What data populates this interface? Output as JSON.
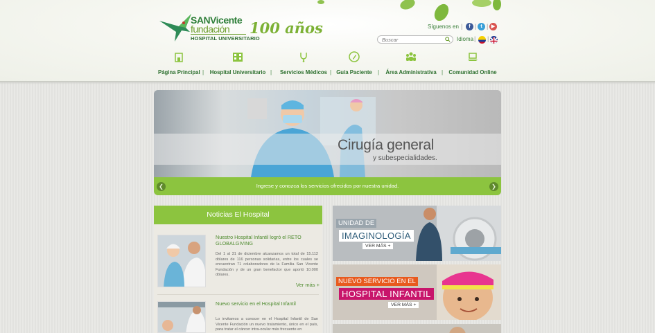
{
  "colors": {
    "green": "#8cc43f",
    "dark_green": "#2c6f2e",
    "magenta": "#c8156b",
    "tag_orange": "#e85a1e"
  },
  "logo": {
    "line1": "SANVicente",
    "line2": "fundación",
    "line3": "HOSPITAL UNIVERSITARIO",
    "anniversary": "100 años"
  },
  "topbar": {
    "follow_label": "Síguenos en",
    "social_icons": [
      "facebook-icon",
      "twitter-icon",
      "youtube-icon"
    ],
    "search_placeholder": "Buscar",
    "language_label": "Idioma",
    "language_flags": [
      "colombia-flag-icon",
      "uk-flag-icon"
    ]
  },
  "nav": {
    "items": [
      {
        "label": "Página Principal",
        "icon": "building-icon"
      },
      {
        "label": "Hospital Universitario",
        "icon": "hospital-icon"
      },
      {
        "label": "Servicios Médicos",
        "icon": "stethoscope-icon"
      },
      {
        "label": "Guía Paciente",
        "icon": "pen-icon"
      },
      {
        "label": "Área Administrativa",
        "icon": "group-icon"
      },
      {
        "label": "Comunidad Online",
        "icon": "laptop-icon"
      }
    ]
  },
  "banner": {
    "title": "Cirugía general",
    "subtitle": "y subespecialidades.",
    "caption": "Ingrese y conozca los servicios ofrecidos por nuestra unidad.",
    "prev_icon": "chevron-left-icon",
    "next_icon": "chevron-right-icon"
  },
  "news": {
    "heading": "Noticias El Hospital",
    "items": [
      {
        "title": "Nuestro Hospital Infantil logró el RETO GLOBALGIVING",
        "body": "Del 1 al 31 de diciembre alcanzamos un total de 15.112 dólares de 116 personas solidarias, entre los cuales se encuentran 71 colaboradores de la Familia San Vicente Fundación y de un gran benefactor que aportó 10.000 dólares.",
        "more": "Ver más +"
      },
      {
        "title": "Nuevo servicio en el Hospital Infantil",
        "body": "Lo invitamos a conocer en el Hospital Infantil de San Vicente Fundación un nuevo tratamiento, único en el país, para tratar el cáncer intra-ocular más frecuente en"
      }
    ]
  },
  "promos": [
    {
      "tag": "UNIDAD DE",
      "title": "IMAGINOLOGÍA",
      "more": "VER MÁS +"
    },
    {
      "tag": "NUEVO SERVICIO EN EL",
      "title": "HOSPITAL INFANTIL",
      "more": "VER MÁS +"
    }
  ]
}
